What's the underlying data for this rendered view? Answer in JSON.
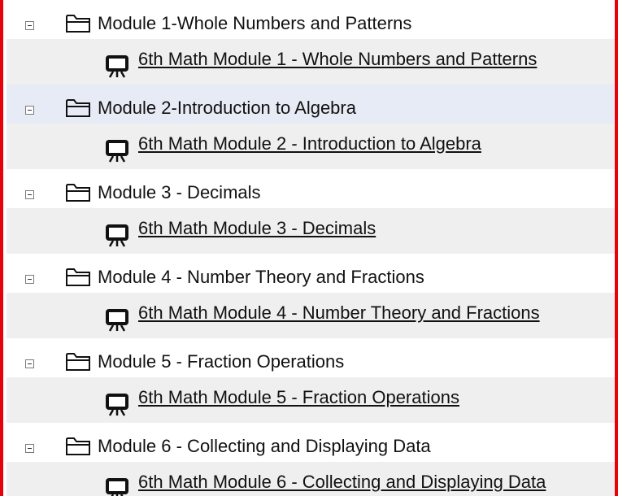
{
  "modules": [
    {
      "title": "Module 1-Whole Numbers and Patterns",
      "item": "6th Math Module 1 - Whole Numbers and Patterns"
    },
    {
      "title": "Module 2-Introduction to Algebra",
      "item": "6th Math Module 2 - Introduction to Algebra"
    },
    {
      "title": "Module 3 - Decimals",
      "item": "6th Math Module 3 - Decimals"
    },
    {
      "title": "Module 4 - Number Theory and Fractions",
      "item": "6th Math Module 4 - Number Theory and Fractions"
    },
    {
      "title": "Module 5 - Fraction Operations",
      "item": "6th Math Module 5 - Fraction Operations"
    },
    {
      "title": "Module 6 - Collecting and Displaying Data",
      "item": "6th Math Module 6 - Collecting and Displaying Data"
    }
  ],
  "icons": {
    "toggle": "collapse-icon",
    "folder": "folder-icon",
    "item": "presentation-icon"
  },
  "colors": {
    "border": "#e8000b",
    "highlight_row": "#e7ebf5",
    "item_row": "#efefef"
  }
}
